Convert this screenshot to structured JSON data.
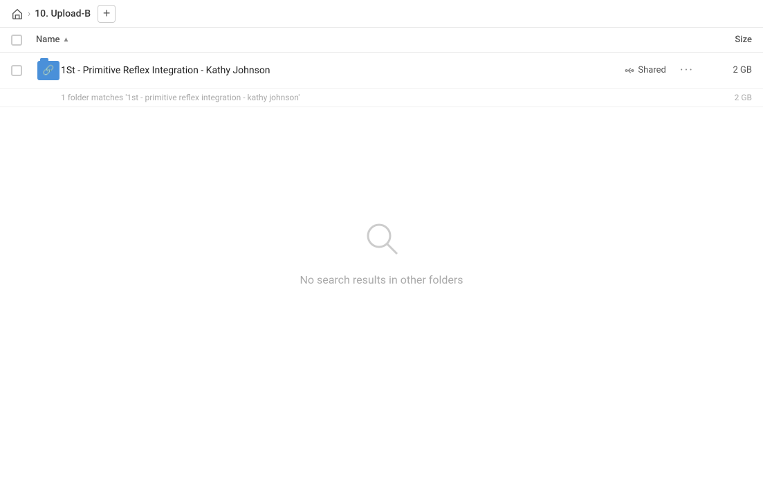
{
  "breadcrumb": {
    "home_label": "Home",
    "current": "10. Upload-B",
    "add_button_label": "+"
  },
  "table_header": {
    "name_label": "Name",
    "sort_indicator": "▲",
    "size_label": "Size"
  },
  "file_row": {
    "name": "1St - Primitive Reflex Integration - Kathy Johnson",
    "shared_label": "Shared",
    "size": "2 GB",
    "match_hint": "1 folder matches '1st - primitive reflex integration - kathy johnson'",
    "match_hint_size": "2 GB"
  },
  "empty_state": {
    "message": "No search results in other folders"
  },
  "icons": {
    "home": "🏠",
    "folder_link": "🔗",
    "shared_link": "🔗",
    "more": "···",
    "search": "🔍"
  }
}
